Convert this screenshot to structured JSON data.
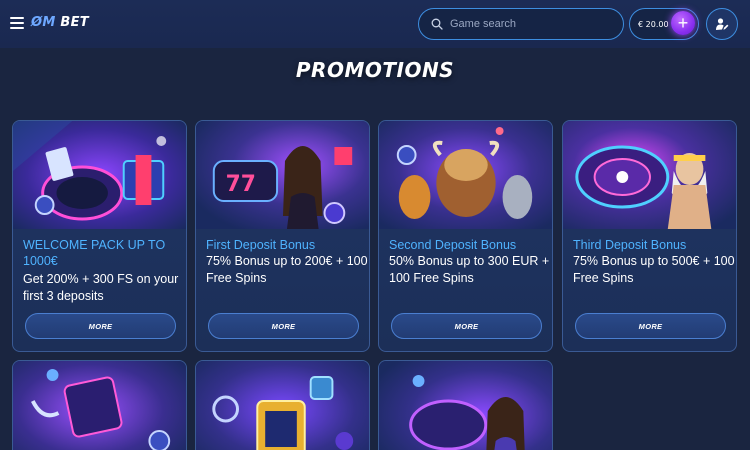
{
  "header": {
    "logo_mark": "ØM",
    "logo_text": " BET",
    "search_placeholder": "Game search",
    "balance": "€ 20.00",
    "plus_label": "+"
  },
  "page": {
    "title": "PROMOTIONS"
  },
  "promotions": [
    {
      "title": "WELCOME PACK UP TO 1000€",
      "desc": "Get 200% + 300 FS on your first 3 deposits",
      "button": "MORE"
    },
    {
      "title": "First Deposit Bonus",
      "desc": "75% Bonus up to 200€ + 100 Free Spins",
      "button": "MORE"
    },
    {
      "title": "Second Deposit Bonus",
      "desc": "50% Bonus up to 300 EUR + 100 Free Spins",
      "button": "MORE"
    },
    {
      "title": "Third Deposit Bonus",
      "desc": "75% Bonus up to 500€ + 100 Free Spins",
      "button": "MORE"
    }
  ],
  "icons": {
    "menu": "hamburger-menu-icon",
    "search": "search-icon",
    "plus": "plus-icon",
    "profile": "user-profile-icon"
  },
  "colors": {
    "background": "#1a2540",
    "accent": "#3d8ee0",
    "promo_title": "#4fb3ff",
    "plus_button": "#8a2ff0"
  }
}
